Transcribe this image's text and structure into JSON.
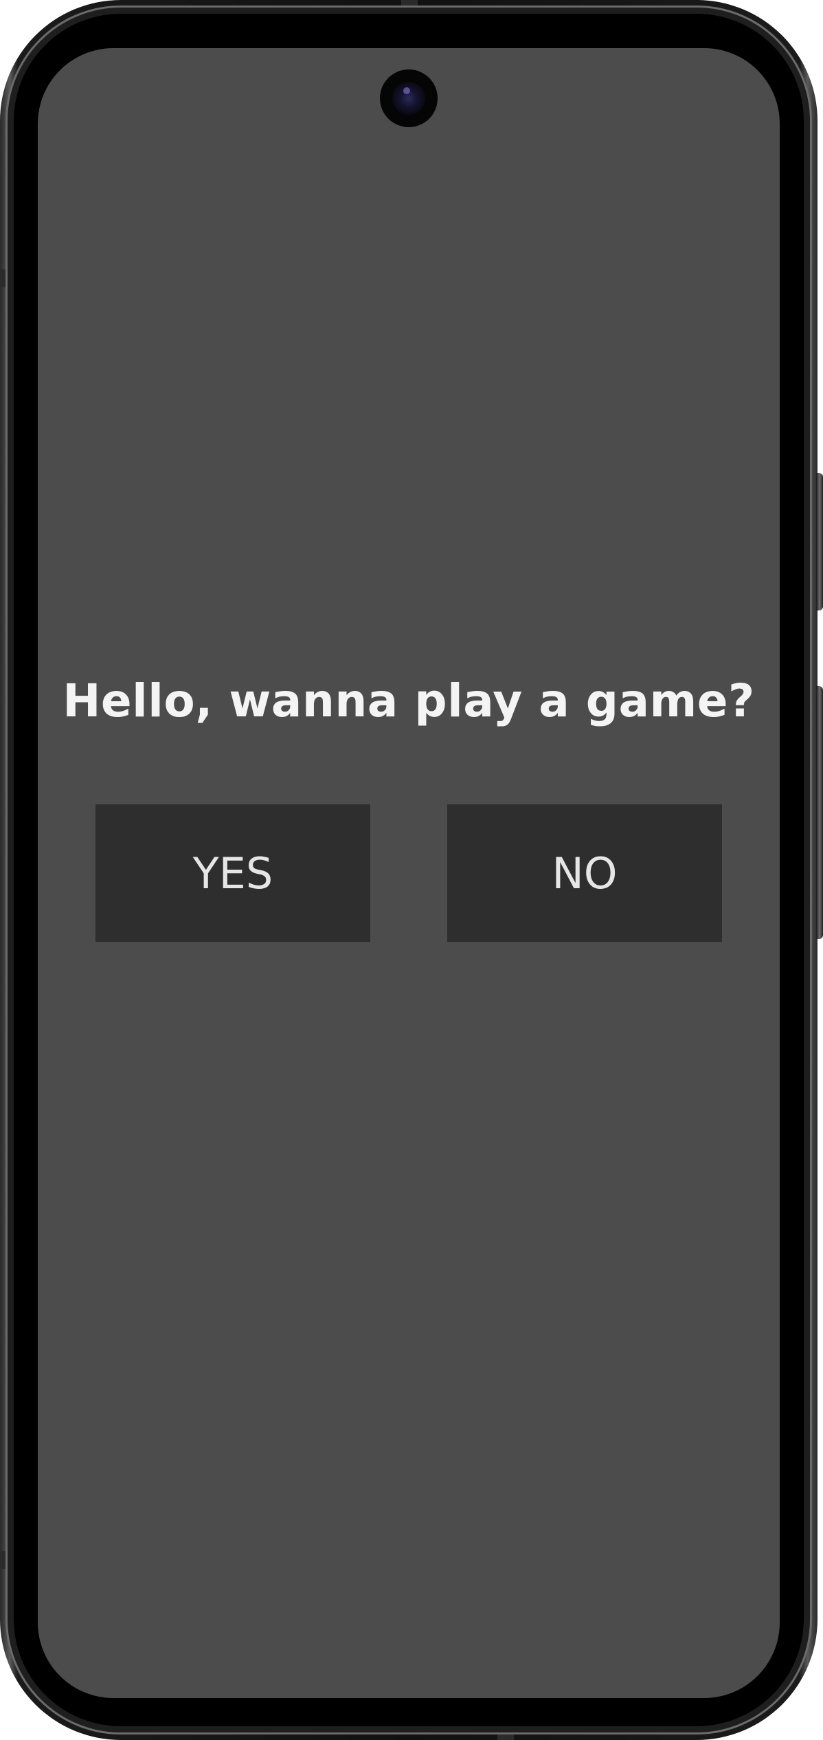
{
  "prompt": {
    "question": "Hello, wanna play a game?"
  },
  "buttons": {
    "yes_label": "YES",
    "no_label": "NO"
  },
  "colors": {
    "screen_background": "#4c4c4c",
    "button_background": "#2e2e2e",
    "text": "#f4f4f4"
  },
  "icons": {
    "camera": "front-camera-icon"
  }
}
